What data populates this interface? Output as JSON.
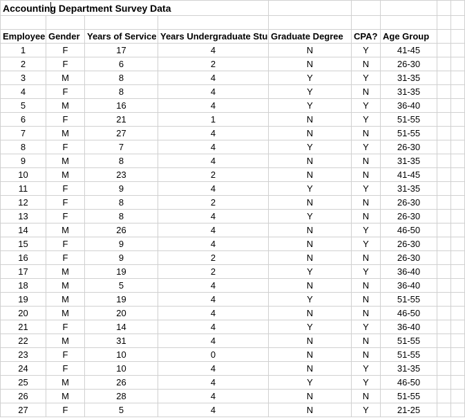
{
  "title": "Accounting Department Survey Data",
  "headers": [
    "Employee",
    "Gender",
    "Years of Service",
    "Years Undergraduate Study",
    "Graduate Degree",
    "CPA?",
    "Age Group"
  ],
  "rows": [
    {
      "emp": "1",
      "gender": "F",
      "service": "17",
      "ug": "4",
      "grad": "N",
      "cpa": "Y",
      "age": "41-45"
    },
    {
      "emp": "2",
      "gender": "F",
      "service": "6",
      "ug": "2",
      "grad": "N",
      "cpa": "N",
      "age": "26-30"
    },
    {
      "emp": "3",
      "gender": "M",
      "service": "8",
      "ug": "4",
      "grad": "Y",
      "cpa": "Y",
      "age": "31-35"
    },
    {
      "emp": "4",
      "gender": "F",
      "service": "8",
      "ug": "4",
      "grad": "Y",
      "cpa": "N",
      "age": "31-35"
    },
    {
      "emp": "5",
      "gender": "M",
      "service": "16",
      "ug": "4",
      "grad": "Y",
      "cpa": "Y",
      "age": "36-40"
    },
    {
      "emp": "6",
      "gender": "F",
      "service": "21",
      "ug": "1",
      "grad": "N",
      "cpa": "Y",
      "age": "51-55"
    },
    {
      "emp": "7",
      "gender": "M",
      "service": "27",
      "ug": "4",
      "grad": "N",
      "cpa": "N",
      "age": "51-55"
    },
    {
      "emp": "8",
      "gender": "F",
      "service": "7",
      "ug": "4",
      "grad": "Y",
      "cpa": "Y",
      "age": "26-30"
    },
    {
      "emp": "9",
      "gender": "M",
      "service": "8",
      "ug": "4",
      "grad": "N",
      "cpa": "N",
      "age": "31-35"
    },
    {
      "emp": "10",
      "gender": "M",
      "service": "23",
      "ug": "2",
      "grad": "N",
      "cpa": "N",
      "age": "41-45"
    },
    {
      "emp": "11",
      "gender": "F",
      "service": "9",
      "ug": "4",
      "grad": "Y",
      "cpa": "Y",
      "age": "31-35"
    },
    {
      "emp": "12",
      "gender": "F",
      "service": "8",
      "ug": "2",
      "grad": "N",
      "cpa": "N",
      "age": "26-30"
    },
    {
      "emp": "13",
      "gender": "F",
      "service": "8",
      "ug": "4",
      "grad": "Y",
      "cpa": "N",
      "age": "26-30"
    },
    {
      "emp": "14",
      "gender": "M",
      "service": "26",
      "ug": "4",
      "grad": "N",
      "cpa": "Y",
      "age": "46-50"
    },
    {
      "emp": "15",
      "gender": "F",
      "service": "9",
      "ug": "4",
      "grad": "N",
      "cpa": "Y",
      "age": "26-30"
    },
    {
      "emp": "16",
      "gender": "F",
      "service": "9",
      "ug": "2",
      "grad": "N",
      "cpa": "N",
      "age": "26-30"
    },
    {
      "emp": "17",
      "gender": "M",
      "service": "19",
      "ug": "2",
      "grad": "Y",
      "cpa": "Y",
      "age": "36-40"
    },
    {
      "emp": "18",
      "gender": "M",
      "service": "5",
      "ug": "4",
      "grad": "N",
      "cpa": "N",
      "age": "36-40"
    },
    {
      "emp": "19",
      "gender": "M",
      "service": "19",
      "ug": "4",
      "grad": "Y",
      "cpa": "N",
      "age": "51-55"
    },
    {
      "emp": "20",
      "gender": "M",
      "service": "20",
      "ug": "4",
      "grad": "N",
      "cpa": "N",
      "age": "46-50"
    },
    {
      "emp": "21",
      "gender": "F",
      "service": "14",
      "ug": "4",
      "grad": "Y",
      "cpa": "Y",
      "age": "36-40"
    },
    {
      "emp": "22",
      "gender": "M",
      "service": "31",
      "ug": "4",
      "grad": "N",
      "cpa": "N",
      "age": "51-55"
    },
    {
      "emp": "23",
      "gender": "F",
      "service": "10",
      "ug": "0",
      "grad": "N",
      "cpa": "N",
      "age": "51-55"
    },
    {
      "emp": "24",
      "gender": "F",
      "service": "10",
      "ug": "4",
      "grad": "N",
      "cpa": "Y",
      "age": "31-35"
    },
    {
      "emp": "25",
      "gender": "M",
      "service": "26",
      "ug": "4",
      "grad": "Y",
      "cpa": "Y",
      "age": "46-50"
    },
    {
      "emp": "26",
      "gender": "M",
      "service": "28",
      "ug": "4",
      "grad": "N",
      "cpa": "N",
      "age": "51-55"
    },
    {
      "emp": "27",
      "gender": "F",
      "service": "5",
      "ug": "4",
      "grad": "N",
      "cpa": "Y",
      "age": "21-25"
    }
  ]
}
